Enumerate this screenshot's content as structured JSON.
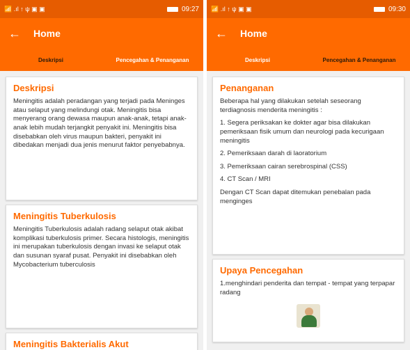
{
  "left": {
    "status": {
      "left": "📶 .ıl ↑ ψ ▣ ▣",
      "time": "09:27"
    },
    "appbar": {
      "title": "Home"
    },
    "tabs": [
      {
        "label": "Deskripsi"
      },
      {
        "label": "Pencegahan & Penanganan"
      }
    ],
    "cards": [
      {
        "title": "Deskripsi",
        "paras": [
          "Meningitis adalah peradangan yang terjadi pada Meninges atau selaput yang melindungi otak. Meningitis bisa menyerang orang dewasa maupun anak-anak, tetapi anak-anak lebih mudah terjangkit penyakit ini. Meningitis bisa disebabkan oleh virus maupun bakteri, penyakit ini dibedakan menjadi dua jenis menurut faktor penyebabnya."
        ]
      },
      {
        "title": "Meningitis Tuberkulosis",
        "paras": [
          "Meningitis Tuberkulosis adalah radang selaput otak akibat komplikasi tuberkulosis primer. Secara histologis, meningitis ini merupakan tuberkulosis dengan invasi ke selaput otak dan susunan syaraf pusat. Penyakit ini disebabkan oleh Mycobacterium tuberculosis"
        ]
      },
      {
        "title": "Meningitis Bakterialis Akut",
        "paras": [
          ""
        ]
      }
    ]
  },
  "right": {
    "status": {
      "left": "📶 .ıl ↑ ψ ▣ ▣",
      "time": "09:30"
    },
    "appbar": {
      "title": "Home"
    },
    "tabs": [
      {
        "label": "Deskripsi"
      },
      {
        "label": "Pencegahan & Penanganan"
      }
    ],
    "cards": [
      {
        "title": "Penanganan",
        "paras": [
          "Beberapa hal yang dilakukan setelah seseorang terdiagnosis menderita meningitis :",
          "1. Segera periksakan ke dokter agar bisa dilakukan pemeriksaan fisik umum dan neurologi pada kecurigaan meningitis",
          "2. Pemeriksaan darah di laoratorium",
          "3. Pemeriksaan cairan serebrospinal (CSS)",
          "4. CT Scan / MRI",
          "   Dengan CT Scan dapat ditemukan penebalan pada menginges"
        ]
      },
      {
        "title": "Upaya Pencegahan",
        "paras": [
          "1.menghindari penderita dan tempat - tempat yang terpapar radang"
        ]
      }
    ]
  },
  "icons": {
    "back": "arrow-left-icon",
    "battery": "battery-icon",
    "avatar": "person-image"
  },
  "colors": {
    "primary": "#ff6a00",
    "status": "#e65c00",
    "text": "#333333"
  }
}
